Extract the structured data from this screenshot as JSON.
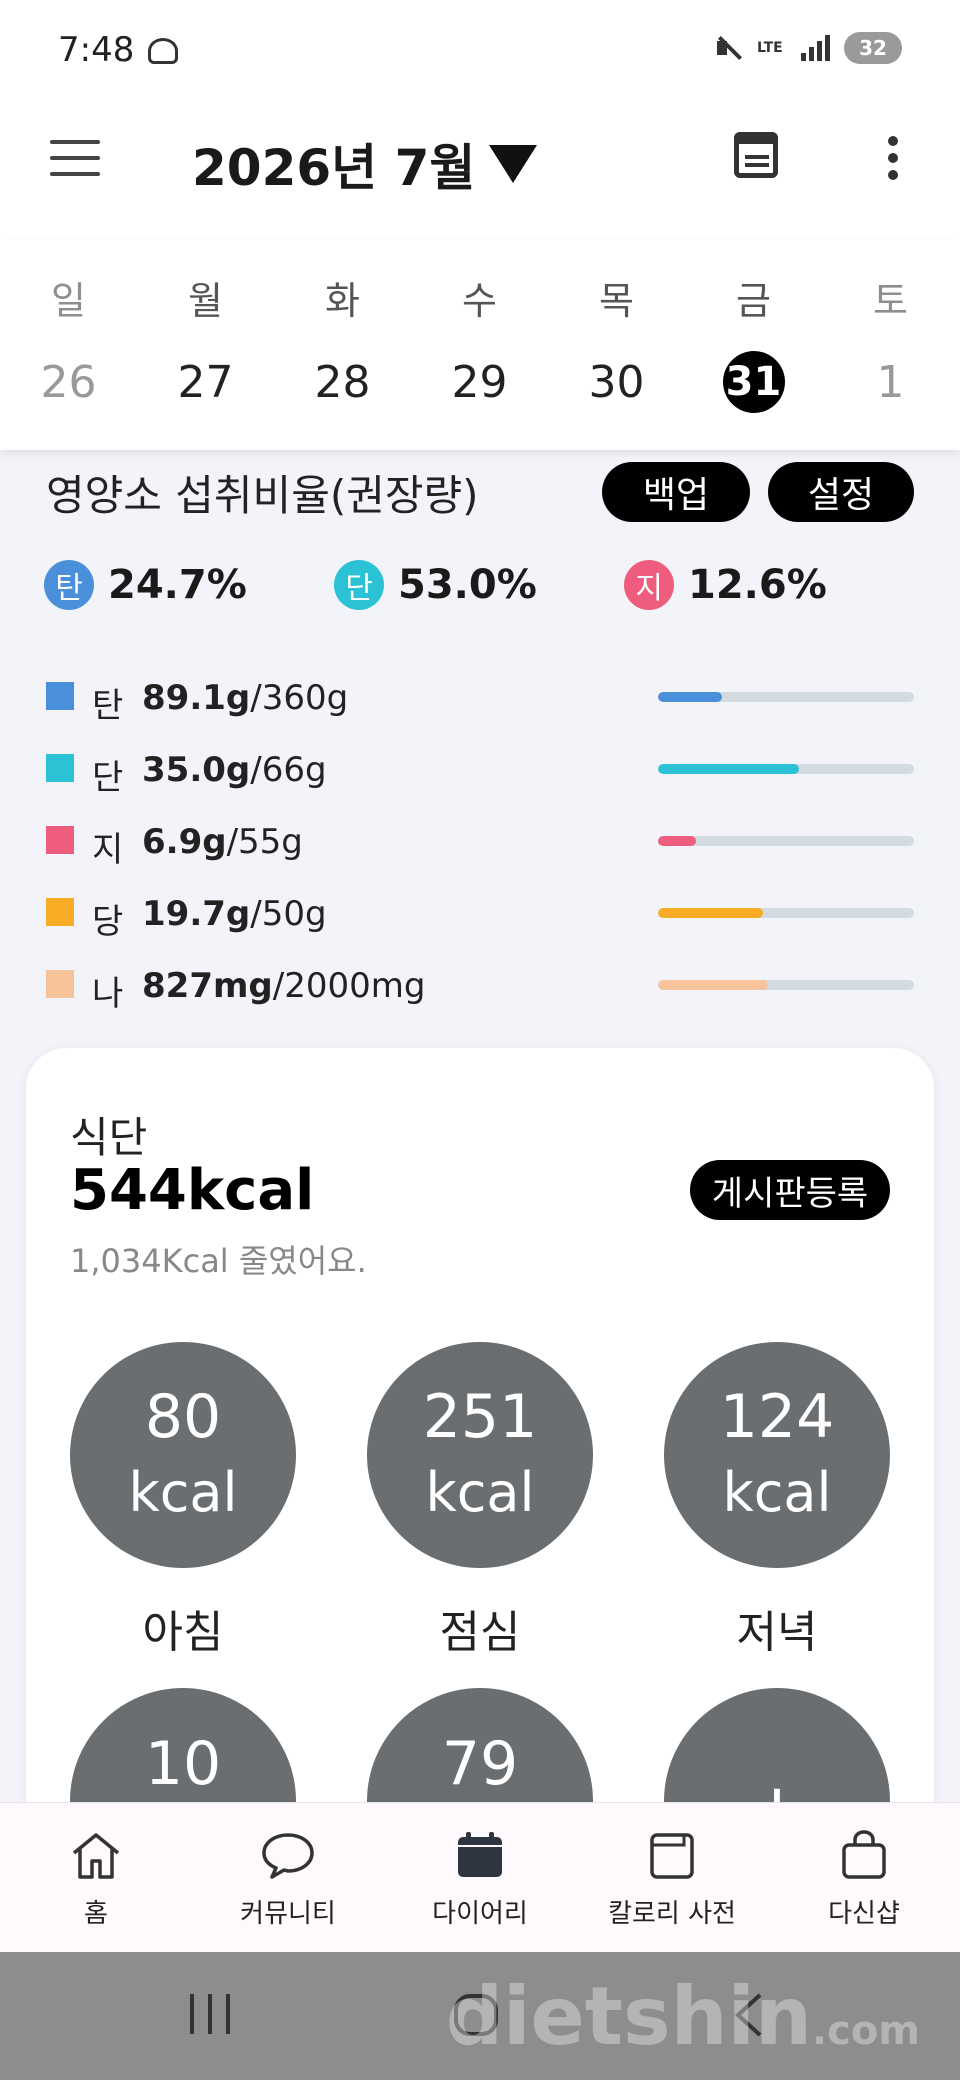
{
  "status": {
    "time": "7:48",
    "network": "LTE",
    "battery": "32"
  },
  "header": {
    "month_title": "2026년 7월"
  },
  "week": {
    "days": [
      {
        "weekday": "일",
        "date": "26"
      },
      {
        "weekday": "월",
        "date": "27"
      },
      {
        "weekday": "화",
        "date": "28"
      },
      {
        "weekday": "수",
        "date": "29"
      },
      {
        "weekday": "목",
        "date": "30"
      },
      {
        "weekday": "금",
        "date": "31"
      },
      {
        "weekday": "토",
        "date": "1"
      }
    ],
    "selected_date": "31"
  },
  "nutrition": {
    "title": "영양소 섭취비율(권장량)",
    "backup_label": "백업",
    "settings_label": "설정",
    "ratios": [
      {
        "symbol": "탄",
        "value": "24.7%",
        "color": "#4a8fd9"
      },
      {
        "symbol": "단",
        "value": "53.0%",
        "color": "#2bc2d6"
      },
      {
        "symbol": "지",
        "value": "12.6%",
        "color": "#ee5d7e"
      }
    ],
    "items": [
      {
        "symbol": "탄",
        "amount": "89.1g",
        "target": "/360g",
        "fraction": 0.25,
        "color": "#4a8fd9"
      },
      {
        "symbol": "단",
        "amount": "35.0g",
        "target": "/66g",
        "fraction": 0.55,
        "color": "#2bc2d6"
      },
      {
        "symbol": "지",
        "amount": "6.9g",
        "target": "/55g",
        "fraction": 0.15,
        "color": "#ee5d7e"
      },
      {
        "symbol": "당",
        "amount": "19.7g",
        "target": "/50g",
        "fraction": 0.41,
        "color": "#f8ab24"
      },
      {
        "symbol": "나",
        "amount": "827mg",
        "target": "/2000mg",
        "fraction": 0.43,
        "color": "#f7c39a"
      }
    ]
  },
  "diet": {
    "label": "식단",
    "total_kcal": "544kcal",
    "note": "1,034Kcal 줄였어요.",
    "board_button": "게시판등록",
    "meals": [
      {
        "kcal": "80",
        "unit": "kcal",
        "name": "아침"
      },
      {
        "kcal": "251",
        "unit": "kcal",
        "name": "점심"
      },
      {
        "kcal": "124",
        "unit": "kcal",
        "name": "저녁"
      },
      {
        "kcal": "10"
      },
      {
        "kcal": "79"
      },
      {
        "kcal": "+"
      }
    ]
  },
  "bottom_nav": {
    "items": [
      {
        "label": "홈",
        "icon": "home-icon"
      },
      {
        "label": "커뮤니티",
        "icon": "chat-bubble-icon"
      },
      {
        "label": "다이어리",
        "icon": "calendar-icon"
      },
      {
        "label": "칼로리 사전",
        "icon": "book-icon"
      },
      {
        "label": "다신샵",
        "icon": "shopping-bag-icon"
      }
    ]
  },
  "watermark": {
    "text": "dietshin",
    "suffix": ".com"
  }
}
